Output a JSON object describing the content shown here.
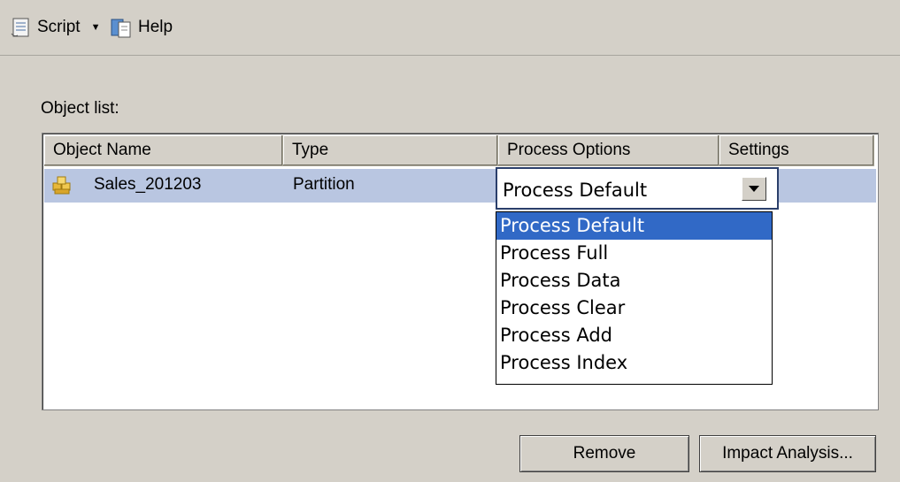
{
  "toolbar": {
    "script_label": "Script",
    "help_label": "Help"
  },
  "object_list_label": "Object list:",
  "columns": [
    "Object Name",
    "Type",
    "Process Options",
    "Settings"
  ],
  "rows": [
    {
      "name": "Sales_201203",
      "type": "Partition",
      "process_option": "Process Default",
      "settings": ""
    }
  ],
  "dropdown": {
    "selected": "Process Default",
    "options": [
      "Process Default",
      "Process Full",
      "Process Data",
      "Process Clear",
      "Process Add",
      "Process Index"
    ]
  },
  "buttons": {
    "remove": "Remove",
    "impact": "Impact Analysis..."
  },
  "colors": {
    "selection": "#3169c6",
    "row_highlight": "#b9c6e1"
  }
}
